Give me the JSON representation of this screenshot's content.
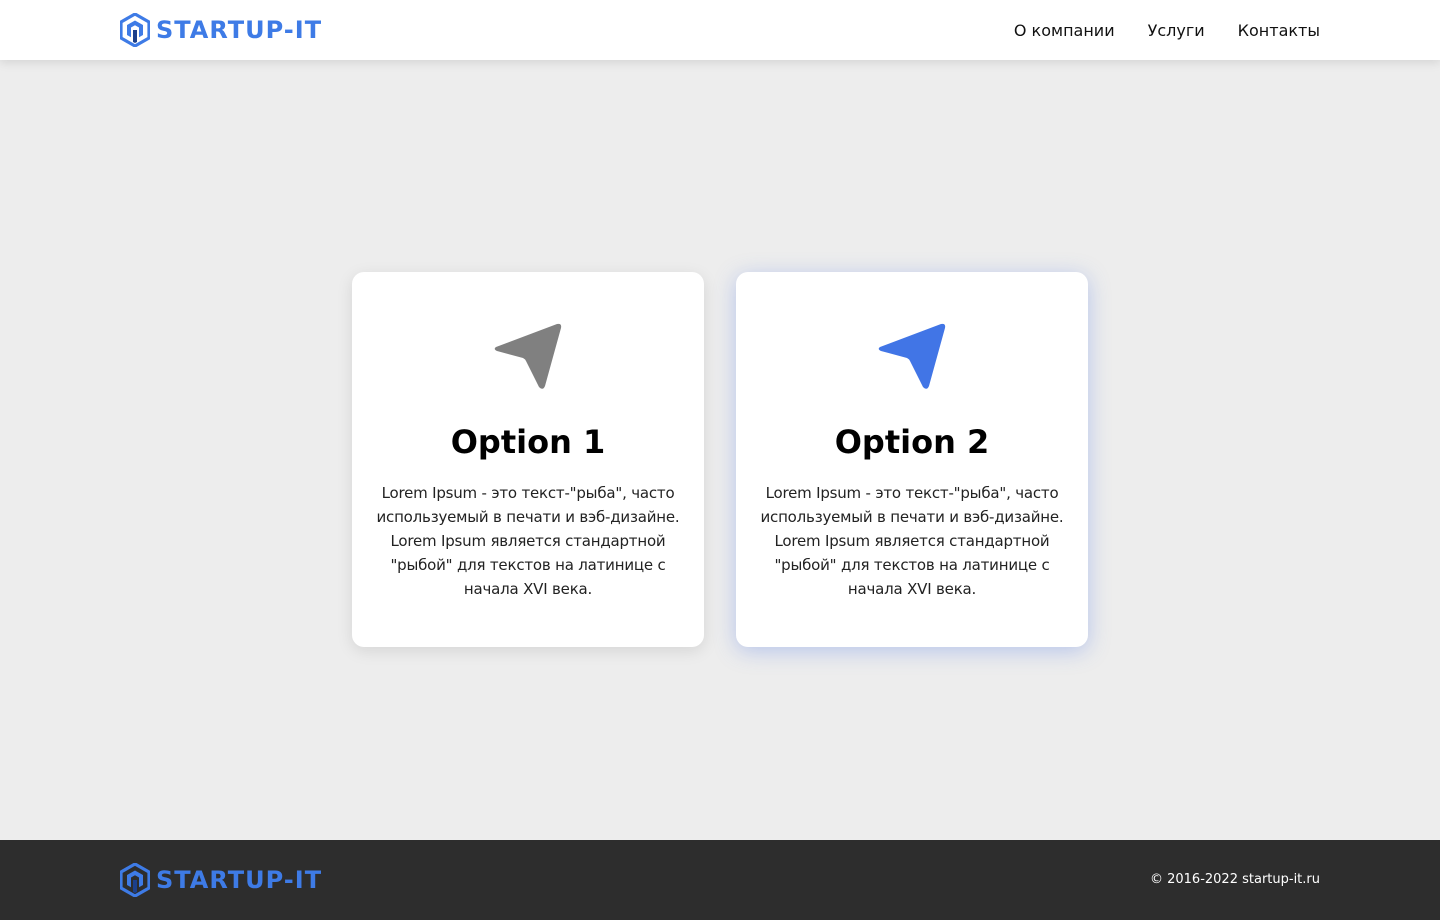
{
  "brand": {
    "name": "STARTUP-IT",
    "color": "#3e7be6"
  },
  "header": {
    "nav": [
      {
        "label": "О компании"
      },
      {
        "label": "Услуги"
      },
      {
        "label": "Контакты"
      }
    ]
  },
  "cards": [
    {
      "icon": "navigation-arrow-icon",
      "icon_color": "#808080",
      "title": "Option 1",
      "text": "Lorem Ipsum - это текст-\"рыба\", часто используемый в печати и вэб-дизайне. Lorem Ipsum является стандартной \"рыбой\" для текстов на латинице с начала XVI века."
    },
    {
      "icon": "navigation-arrow-icon",
      "icon_color": "#4175e6",
      "title": "Option 2",
      "text": "Lorem Ipsum - это текст-\"рыба\", часто используемый в печати и вэб-дизайне. Lorem Ipsum является стандартной \"рыбой\" для текстов на латинице с начала XVI века."
    }
  ],
  "footer": {
    "copyright": "© 2016-2022 startup-it.ru"
  }
}
